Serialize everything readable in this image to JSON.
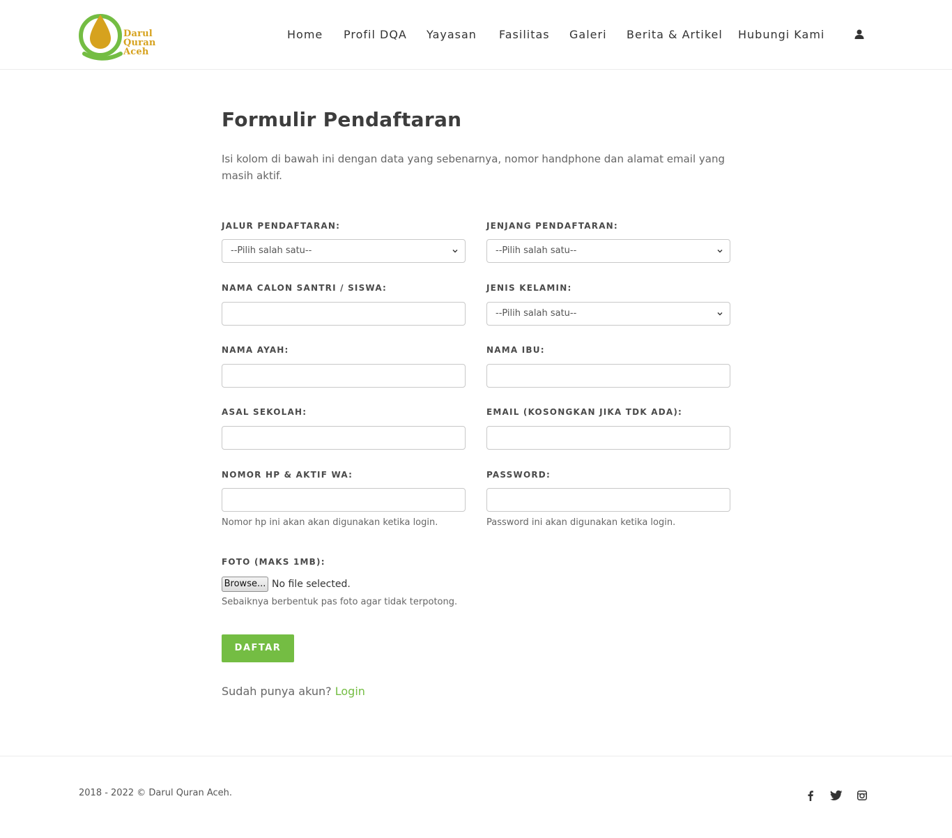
{
  "brand": {
    "logo_line1": "Darul",
    "logo_line2": "Quran",
    "logo_line3": "Aceh",
    "green": "#74bd43",
    "gold": "#d6a21e"
  },
  "nav": {
    "items": [
      "Home",
      "Profil DQA",
      "Yayasan",
      "Fasilitas",
      "Galeri",
      "Berita & Artikel",
      "Hubungi Kami"
    ],
    "user_icon": "user-icon"
  },
  "form": {
    "title": "Formulir Pendaftaran",
    "intro": "Isi kolom di bawah ini dengan data yang sebenarnya, nomor handphone dan alamat email yang masih aktif.",
    "jalur_label": "JALUR PENDAFTARAN:",
    "jalur_value": "--Pilih salah satu--",
    "jenjang_label": "JENJANG PENDAFTARAN:",
    "jenjang_value": "--Pilih salah satu--",
    "nama_santri_label": "NAMA CALON SANTRI / SISWA:",
    "nama_santri_value": "",
    "jenis_kelamin_label": "JENIS KELAMIN:",
    "jenis_kelamin_value": "--Pilih salah satu--",
    "nama_ayah_label": "NAMA AYAH:",
    "nama_ayah_value": "",
    "nama_ibu_label": "NAMA IBU:",
    "nama_ibu_value": "",
    "asal_sekolah_label": "ASAL SEKOLAH:",
    "asal_sekolah_value": "",
    "email_label": "EMAIL (KOSONGKAN JIKA TDK ADA):",
    "email_value": "",
    "nomor_hp_label": "NOMOR HP & AKTIF WA:",
    "nomor_hp_value": "",
    "nomor_hp_help": "Nomor hp ini akan akan digunakan ketika login.",
    "password_label": "PASSWORD:",
    "password_value": "",
    "password_help": "Password ini akan digunakan ketika login.",
    "foto_label": "FOTO (MAKS 1MB):",
    "browse_label": "Browse...",
    "no_file": "No file selected.",
    "foto_help": "Sebaiknya berbentuk pas foto agar tidak terpotong.",
    "submit_label": "DAFTAR",
    "login_prompt": "Sudah punya akun?",
    "login_link": "Login"
  },
  "footer": {
    "copyright": "2018 - 2022 © Darul Quran Aceh.",
    "social": [
      "facebook-icon",
      "twitter-icon",
      "instagram-icon"
    ]
  }
}
